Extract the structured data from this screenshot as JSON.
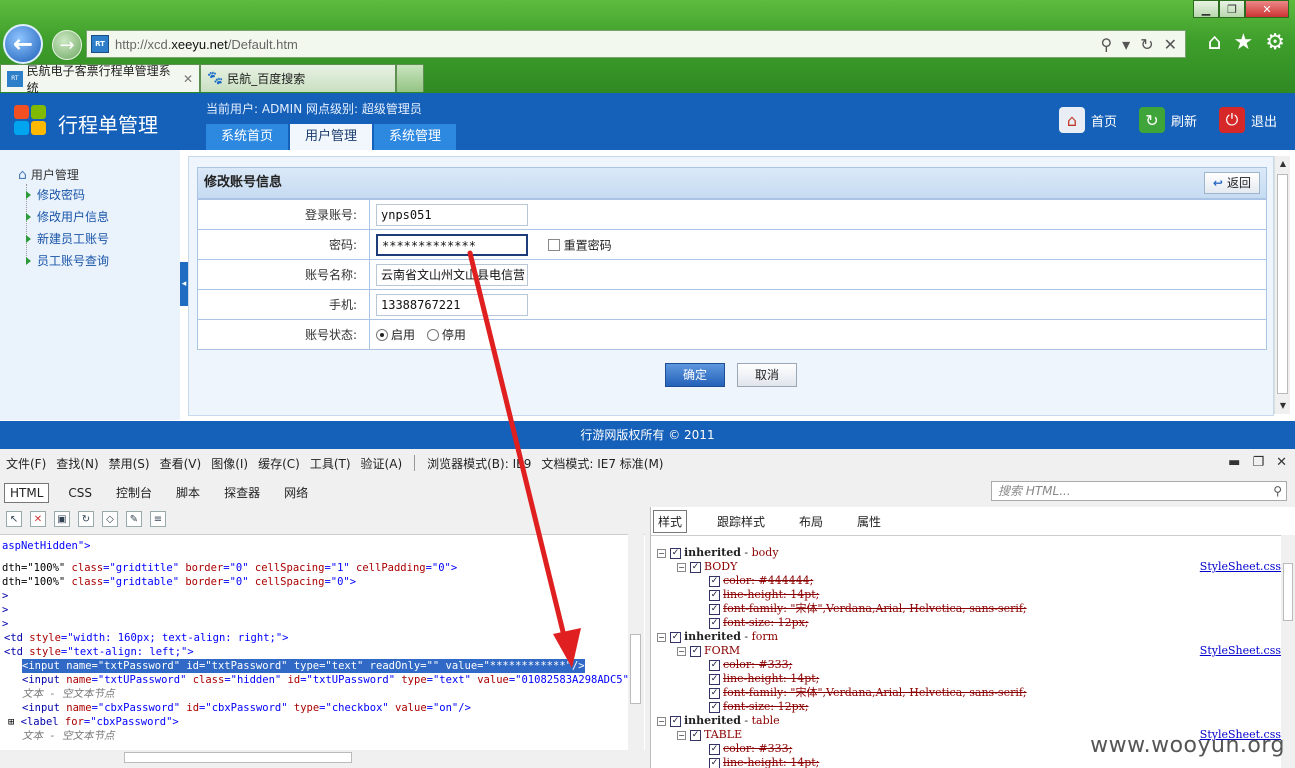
{
  "browser": {
    "url_prefix": "http://xcd.",
    "url_domain": "xeeyu.net",
    "url_path": "/Default.htm",
    "site_icon_text": "RT\n400",
    "tabs": [
      {
        "label": "民航电子客票行程单管理系统",
        "active": true
      },
      {
        "label": "民航_百度搜索",
        "active": false
      }
    ]
  },
  "app": {
    "title": "行程单管理",
    "user_info": "当前用户: ADMIN 网点级别: 超级管理员",
    "nav_tabs": [
      "系统首页",
      "用户管理",
      "系统管理"
    ],
    "active_nav": 1,
    "actions": {
      "home": "首页",
      "refresh": "刷新",
      "exit": "退出"
    },
    "footer": "行游网版权所有 © 2011"
  },
  "sidebar": {
    "root": "用户管理",
    "items": [
      "修改密码",
      "修改用户信息",
      "新建员工账号",
      "员工账号查询"
    ]
  },
  "form": {
    "title": "修改账号信息",
    "back_label": "返回",
    "rows": {
      "login_label": "登录账号:",
      "login_value": "ynps051",
      "password_label": "密码:",
      "password_value": "*************",
      "reset_password_label": "重置密码",
      "account_name_label": "账号名称:",
      "account_name_value": "云南省文山州文山县电信营",
      "phone_label": "手机:",
      "phone_value": "13388767221",
      "status_label": "账号状态:",
      "status_enabled": "启用",
      "status_disabled": "停用"
    },
    "confirm_label": "确定",
    "cancel_label": "取消"
  },
  "devtools": {
    "menu": [
      "文件(F)",
      "查找(N)",
      "禁用(S)",
      "查看(V)",
      "图像(I)",
      "缓存(C)",
      "工具(T)",
      "验证(A)"
    ],
    "browser_mode": "浏览器模式(B): IE9",
    "doc_mode": "文档模式: IE7 标准(M)",
    "tabs": [
      "HTML",
      "CSS",
      "控制台",
      "脚本",
      "探查器",
      "网络"
    ],
    "search_placeholder": "搜索 HTML...",
    "style_tabs": [
      "样式",
      "跟踪样式",
      "布局",
      "属性"
    ],
    "code": {
      "l0": "aspNetHidden\">",
      "l1a": "dth=\"100%\" ",
      "l1b": "class",
      "l1c": "=\"gridtitle\" ",
      "l1d": "border",
      "l1e": "=\"0\" ",
      "l1f": "cellSpacing",
      "l1g": "=\"1\" ",
      "l1h": "cellPadding",
      "l1i": "=\"0\">",
      "l2a": "dth=\"100%\" ",
      "l2b": "class",
      "l2c": "=\"gridtable\" ",
      "l2d": "border",
      "l2e": "=\"0\" ",
      "l2f": "cellSpacing",
      "l2g": "=\"0\">",
      "l3": ">",
      "l4": ">",
      "l5": ">",
      "l6a": "<td ",
      "l6b": "style",
      "l6c": "=\"width: 160px; text-align: right;\">",
      "l7a": "<td ",
      "l7b": "style",
      "l7c": "=\"text-align: left;\">",
      "l8": "<input name=\"txtPassword\" id=\"txtPassword\" type=\"text\" readOnly=\"\" value=\"************\"/>",
      "l9a": "<input ",
      "l9b": "name",
      "l9c": "=\"txtUPassword\" ",
      "l9d": "class",
      "l9e": "=\"hidden\" ",
      "l9f": "id",
      "l9g": "=\"txtUPassword\" ",
      "l9h": "type",
      "l9i": "=\"text\" ",
      "l9j": "value",
      "l9k": "=\"01082583A298ADC5\"/>",
      "l10": "文本 - 空文本节点",
      "l11a": "<input ",
      "l11b": "name",
      "l11c": "=\"cbxPassword\" ",
      "l11d": "id",
      "l11e": "=\"cbxPassword\" ",
      "l11f": "type",
      "l11g": "=\"checkbox\" ",
      "l11h": "value",
      "l11i": "=\"on\"/>",
      "l12a": "<label ",
      "l12b": "for",
      "l12c": "=\"cbxPassword\">",
      "l13": "文本 - 空文本节点"
    },
    "styles": {
      "inherited": "inherited",
      "body_sel": "body",
      "body_tag": "BODY",
      "form_sel": "form",
      "form_tag": "FORM",
      "table_sel": "table",
      "table_tag": "TABLE",
      "link": "StyleSheet.css",
      "p_color_444": "color: #444444;",
      "p_lh": "line-height: 14pt;",
      "p_ff": "font-family: \"宋体\",Verdana,Arial, Helvetica, sans-serif;",
      "p_fs": "font-size: 12px;",
      "p_color_333": "color: #333;"
    }
  },
  "watermark": "www.wooyun.org",
  "colors": {
    "header_blue": "#1560b8",
    "chrome_green": "#3e9e2b",
    "highlight": "#3169c6",
    "arrow_red": "#e02020"
  }
}
